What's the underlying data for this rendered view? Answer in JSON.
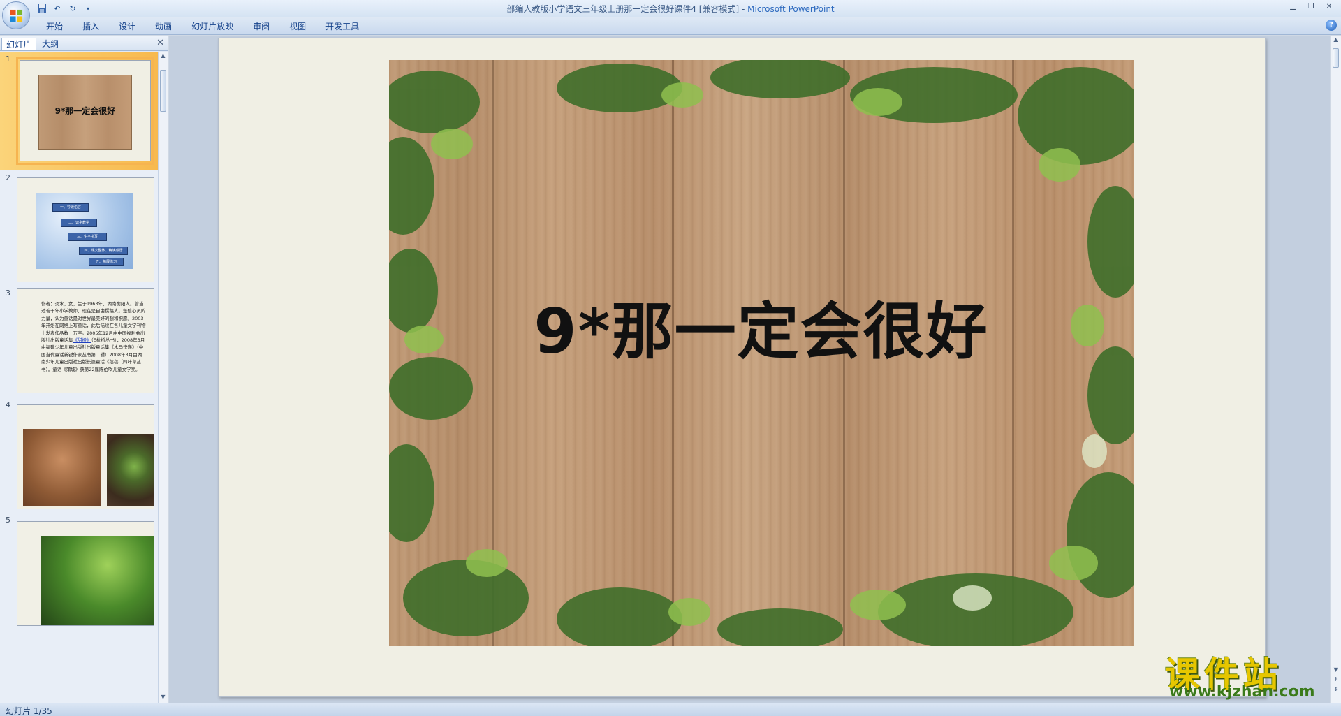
{
  "window": {
    "title_doc": "部编人教版小学语文三年级上册那一定会很好课件4 [兼容模式] - ",
    "title_app": "Microsoft PowerPoint"
  },
  "ribbon": {
    "tabs": [
      "开始",
      "插入",
      "设计",
      "动画",
      "幻灯片放映",
      "审阅",
      "视图",
      "开发工具"
    ]
  },
  "left_pane": {
    "tab_slides": "幻灯片",
    "tab_outline": "大纲",
    "slides": [
      {
        "num": "1",
        "title": "9*那一定会很好"
      },
      {
        "num": "2",
        "items": [
          "一、导读语言",
          "二、识字教学",
          "三、生字书写",
          "四、课文整体、精读感悟",
          "五、拓展练习"
        ]
      },
      {
        "num": "3",
        "text": "作者：淡水，女，生于1963年，湖南衡阳人。曾当过若干年小学教师，现在是自由撰稿人。坚信心灵的力量，认为童话是对世界最美好的想和祝愿。2003年开始在网络上写童话，此后陆续在各儿童文学刊物上发表作品数十万字。2005年12月由中国福利会出版社出版童话集《甜橙》（E枕桥丛书），2008年3月由福建少年儿童出版社出版童话集《木马快递》（中国当代童话新锐作家丛书第二辑）2008年3月由湖南少年儿童出版社出版长篇童话《蓓蓓（四叶草丛书）。童话《蒲坡》获第22届陈伯吹儿童文学奖。",
        "link": "《甜橙》"
      },
      {
        "num": "4"
      },
      {
        "num": "5"
      }
    ]
  },
  "slide": {
    "title": "9*那一定会很好"
  },
  "status": {
    "text": "幻灯片 1/35"
  },
  "watermark": {
    "main": "课件站",
    "url": "www.kjzhan.com"
  }
}
